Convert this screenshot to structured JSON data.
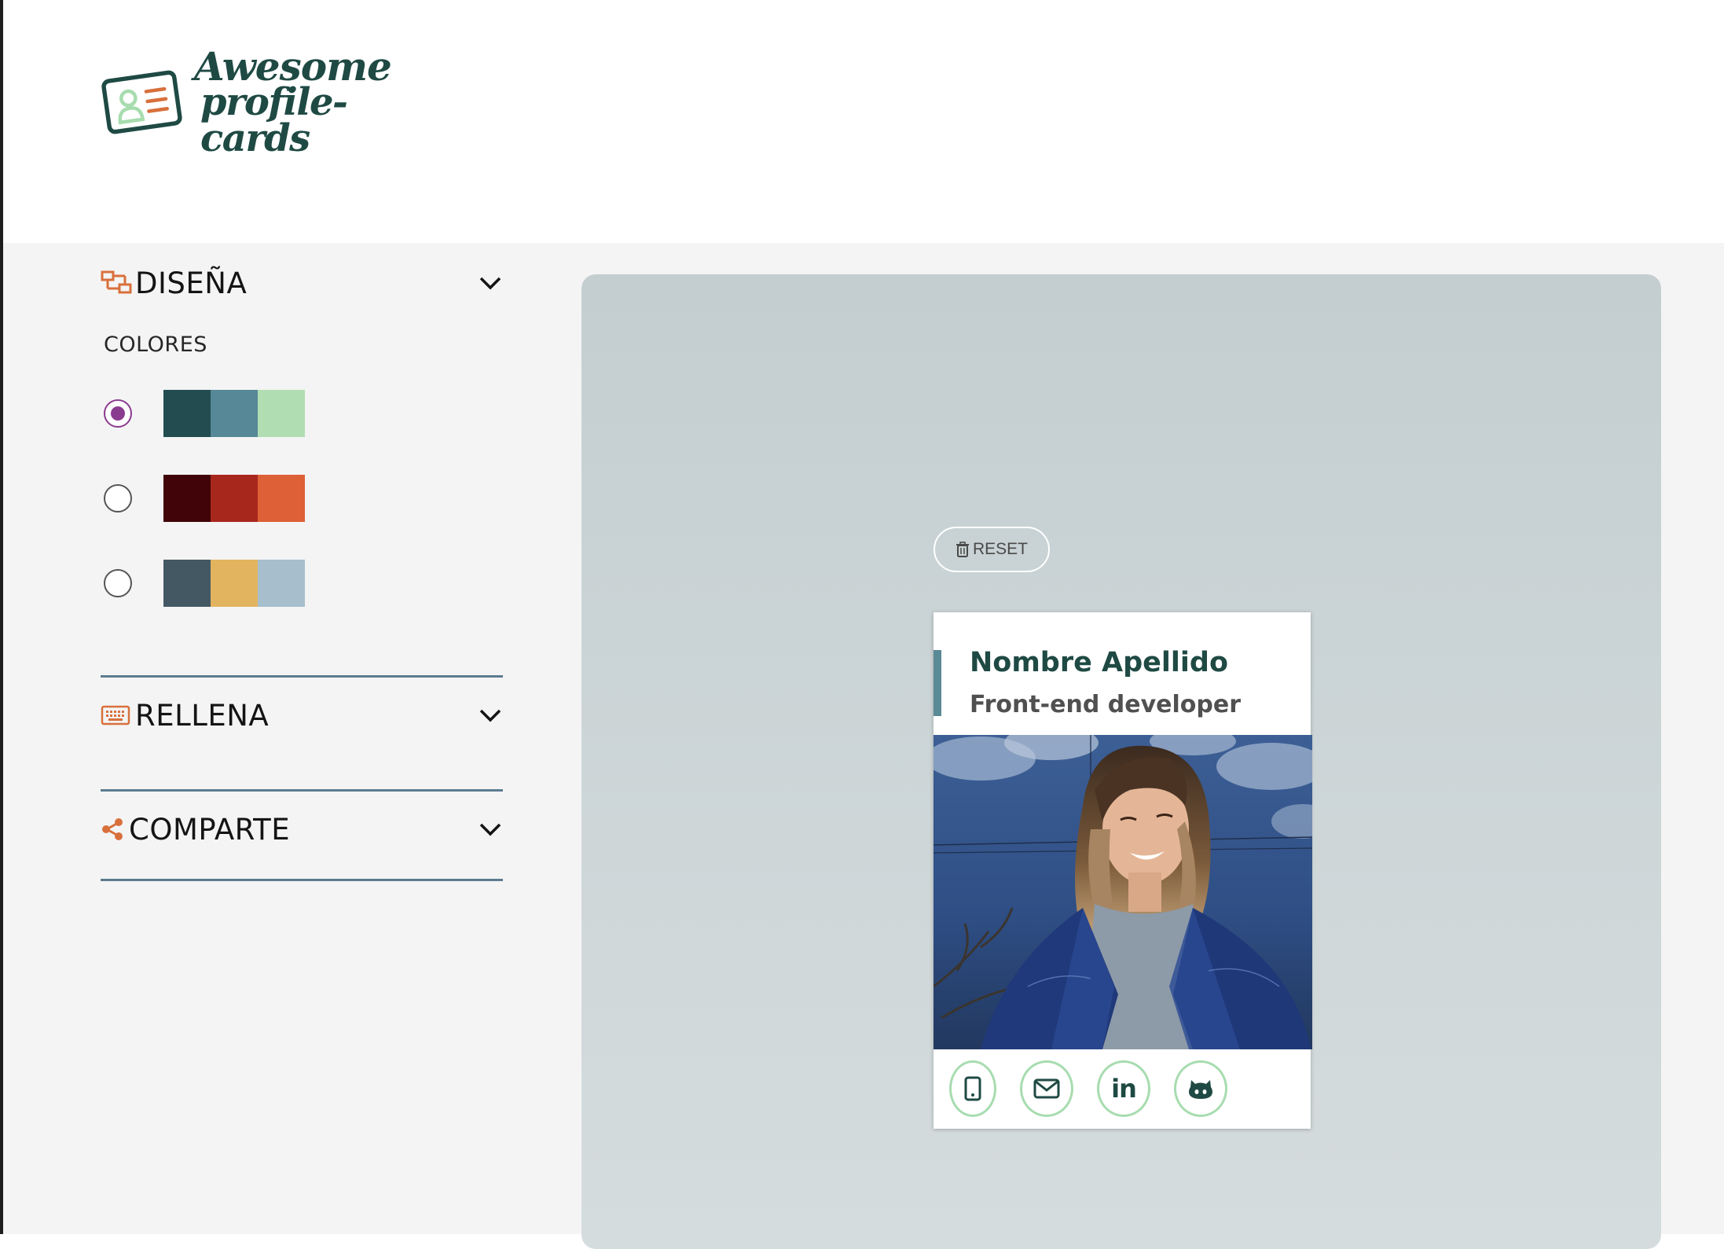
{
  "header": {
    "logo_line1": "Awesome",
    "logo_line2": "profile-cards"
  },
  "sidebar": {
    "design": {
      "title": "DISEÑA",
      "icon": "layout-design-icon",
      "colors_label": "COLORES",
      "palettes": [
        {
          "id": "palette-1",
          "checked": true,
          "colors": [
            "#224c4f",
            "#568897",
            "#b1ddb2"
          ]
        },
        {
          "id": "palette-2",
          "checked": false,
          "colors": [
            "#410408",
            "#a8271d",
            "#dd6036"
          ]
        },
        {
          "id": "palette-3",
          "checked": false,
          "colors": [
            "#445864",
            "#e3b45f",
            "#a7bfcc"
          ]
        }
      ]
    },
    "fill": {
      "title": "RELLENA",
      "icon": "keyboard-icon"
    },
    "share": {
      "title": "COMPARTE",
      "icon": "share-icon"
    }
  },
  "preview": {
    "reset_label": "RESET",
    "card": {
      "name": "Nombre Apellido",
      "job": "Front-end developer",
      "photo_icon": "profile-photo",
      "social": [
        {
          "id": "phone",
          "icon": "mobile-phone-icon"
        },
        {
          "id": "email",
          "icon": "envelope-icon"
        },
        {
          "id": "linkedin",
          "icon": "linkedin-icon",
          "text": "in"
        },
        {
          "id": "github",
          "icon": "github-icon"
        }
      ]
    }
  },
  "colors": {
    "accent_orange": "#d8703c",
    "dark_green": "#1f4a44",
    "radio_selected": "#8a3c8f",
    "divider": "#5b7c90",
    "social_border": "#a7dcaf"
  }
}
